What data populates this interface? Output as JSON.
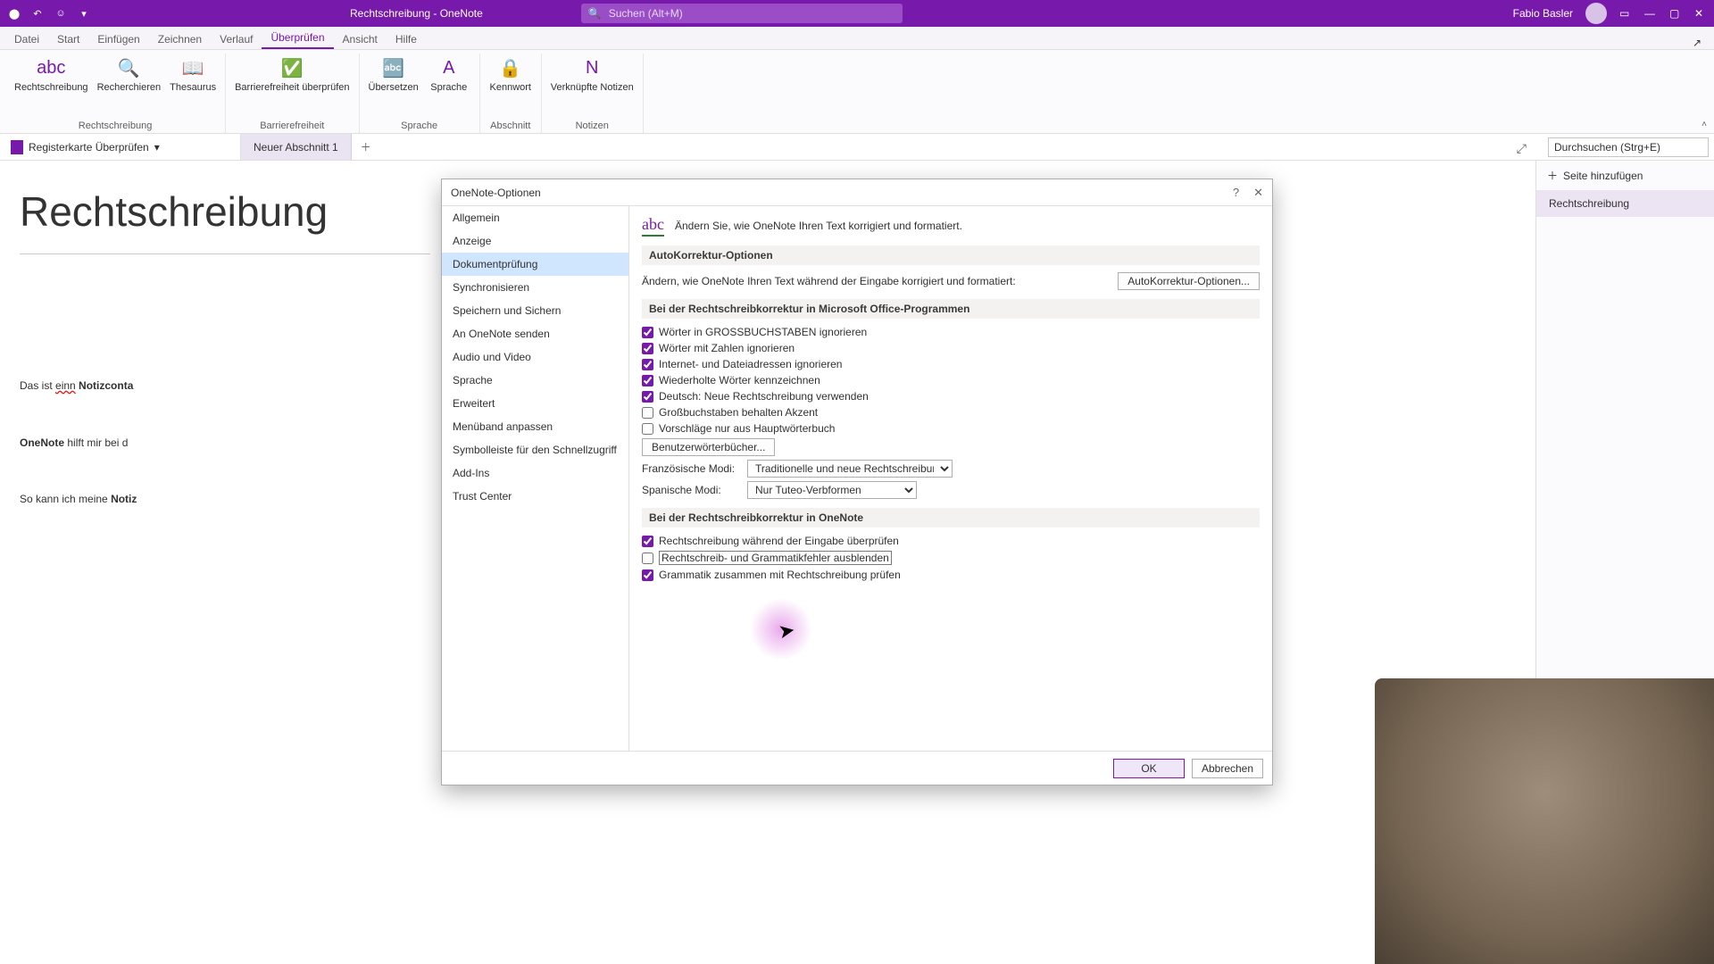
{
  "titlebar": {
    "title": "Rechtschreibung - OneNote",
    "search_placeholder": "Suchen (Alt+M)",
    "user_name": "Fabio Basler"
  },
  "ribbon_tabs": [
    "Datei",
    "Start",
    "Einfügen",
    "Zeichnen",
    "Verlauf",
    "Überprüfen",
    "Ansicht",
    "Hilfe"
  ],
  "ribbon_active_index": 5,
  "ribbon_groups": [
    {
      "label": "Rechtschreibung",
      "buttons": [
        {
          "icon": "abc",
          "label": "Rechtschreibung"
        },
        {
          "icon": "🔍",
          "label": "Recherchieren"
        },
        {
          "icon": "📖",
          "label": "Thesaurus"
        }
      ]
    },
    {
      "label": "Barrierefreiheit",
      "buttons": [
        {
          "icon": "✅",
          "label": "Barrierefreiheit überprüfen"
        }
      ]
    },
    {
      "label": "Sprache",
      "buttons": [
        {
          "icon": "🔤",
          "label": "Übersetzen"
        },
        {
          "icon": "A",
          "label": "Sprache"
        }
      ]
    },
    {
      "label": "Abschnitt",
      "buttons": [
        {
          "icon": "🔒",
          "label": "Kennwort"
        }
      ]
    },
    {
      "label": "Notizen",
      "buttons": [
        {
          "icon": "N",
          "label": "Verknüpfte Notizen"
        }
      ]
    }
  ],
  "section_row": {
    "notebook": "Registerkarte Überprüfen",
    "tabs": [
      "Neuer Abschnitt 1"
    ],
    "search_placeholder": "Durchsuchen (Strg+E)"
  },
  "pagelist": {
    "add_label": "Seite hinzufügen",
    "items": [
      "Rechtschreibung"
    ]
  },
  "canvas": {
    "title": "Rechtschreibung",
    "line1_pre": "Das ist ",
    "line1_err": "einn",
    "line1_bold": "Notizconta",
    "line2_bold": "OneNote",
    "line2_rest": " hilft mir bei d",
    "line3_pre": "So kann ich meine ",
    "line3_bold": "Notiz"
  },
  "dialog": {
    "title": "OneNote-Optionen",
    "help": "?",
    "close": "✕",
    "nav": [
      "Allgemein",
      "Anzeige",
      "Dokumentprüfung",
      "Synchronisieren",
      "Speichern und Sichern",
      "An OneNote senden",
      "Audio und Video",
      "Sprache",
      "Erweitert",
      "Menüband anpassen",
      "Symbolleiste für den Schnellzugriff",
      "Add-Ins",
      "Trust Center"
    ],
    "nav_selected_index": 2,
    "intro": "Ändern Sie, wie OneNote Ihren Text korrigiert und formatiert.",
    "sec1": {
      "title": "AutoKorrektur-Optionen",
      "desc": "Ändern, wie OneNote Ihren Text während der Eingabe korrigiert und formatiert:",
      "btn": "AutoKorrektur-Optionen..."
    },
    "sec2": {
      "title": "Bei der Rechtschreibkorrektur in Microsoft Office-Programmen",
      "checks": [
        {
          "label": "Wörter in GROSSBUCHSTABEN ignorieren",
          "checked": true
        },
        {
          "label": "Wörter mit Zahlen ignorieren",
          "checked": true
        },
        {
          "label": "Internet- und Dateiadressen ignorieren",
          "checked": true
        },
        {
          "label": "Wiederholte Wörter kennzeichnen",
          "checked": true
        },
        {
          "label": "Deutsch: Neue Rechtschreibung verwenden",
          "checked": true
        },
        {
          "label": "Großbuchstaben behalten Akzent",
          "checked": false
        },
        {
          "label": "Vorschläge nur aus Hauptwörterbuch",
          "checked": false
        }
      ],
      "dict_btn": "Benutzerwörterbücher...",
      "fr_label": "Französische Modi:",
      "fr_value": "Traditionelle und neue Rechtschreibung",
      "es_label": "Spanische Modi:",
      "es_value": "Nur Tuteo-Verbformen"
    },
    "sec3": {
      "title": "Bei der Rechtschreibkorrektur in OneNote",
      "checks": [
        {
          "label": "Rechtschreibung während der Eingabe überprüfen",
          "checked": true
        },
        {
          "label": "Rechtschreib- und Grammatikfehler ausblenden",
          "checked": false,
          "focused": true
        },
        {
          "label": "Grammatik zusammen mit Rechtschreibung prüfen",
          "checked": true
        }
      ]
    },
    "ok": "OK",
    "cancel": "Abbrechen"
  }
}
